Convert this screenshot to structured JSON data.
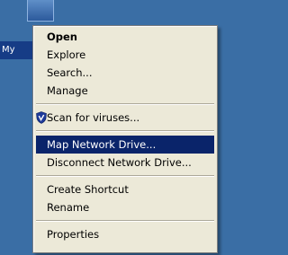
{
  "desktop": {
    "icon_label": "My"
  },
  "context_menu": {
    "group1": [
      {
        "label": "Open",
        "bold": true
      },
      {
        "label": "Explore"
      },
      {
        "label": "Search..."
      },
      {
        "label": "Manage"
      }
    ],
    "scan": {
      "label": "Scan for viruses...",
      "icon": "shield-icon"
    },
    "group3": [
      {
        "label": "Map Network Drive...",
        "selected": true
      },
      {
        "label": "Disconnect Network Drive..."
      }
    ],
    "group4": [
      {
        "label": "Create Shortcut"
      },
      {
        "label": "Rename"
      }
    ],
    "group5": [
      {
        "label": "Properties"
      }
    ]
  },
  "colors": {
    "desktop": "#3a6ea5",
    "menu_bg": "#ece9d8",
    "highlight": "#0a246a"
  }
}
